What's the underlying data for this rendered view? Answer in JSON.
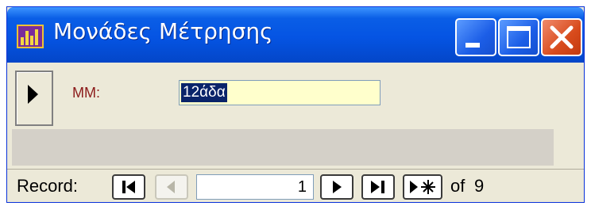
{
  "window": {
    "title": "Μονάδες Μέτρησης",
    "app_icon": "access-form-icon",
    "controls": [
      "minimize-icon",
      "maximize-icon",
      "close-icon"
    ]
  },
  "form": {
    "field_label": "ΜΜ:",
    "field_value": "12άδα"
  },
  "navigation": {
    "record_label": "Record:",
    "current_record": "1",
    "of_label": "of",
    "total_records": "9",
    "buttons": [
      "first-record-icon",
      "previous-record-icon",
      "next-record-icon",
      "last-record-icon",
      "new-record-icon"
    ]
  },
  "colors": {
    "titlebar": "#0554e3",
    "close_button": "#d84b1c",
    "field_background": "#ffffcc",
    "label_text": "#8b1a1a"
  }
}
